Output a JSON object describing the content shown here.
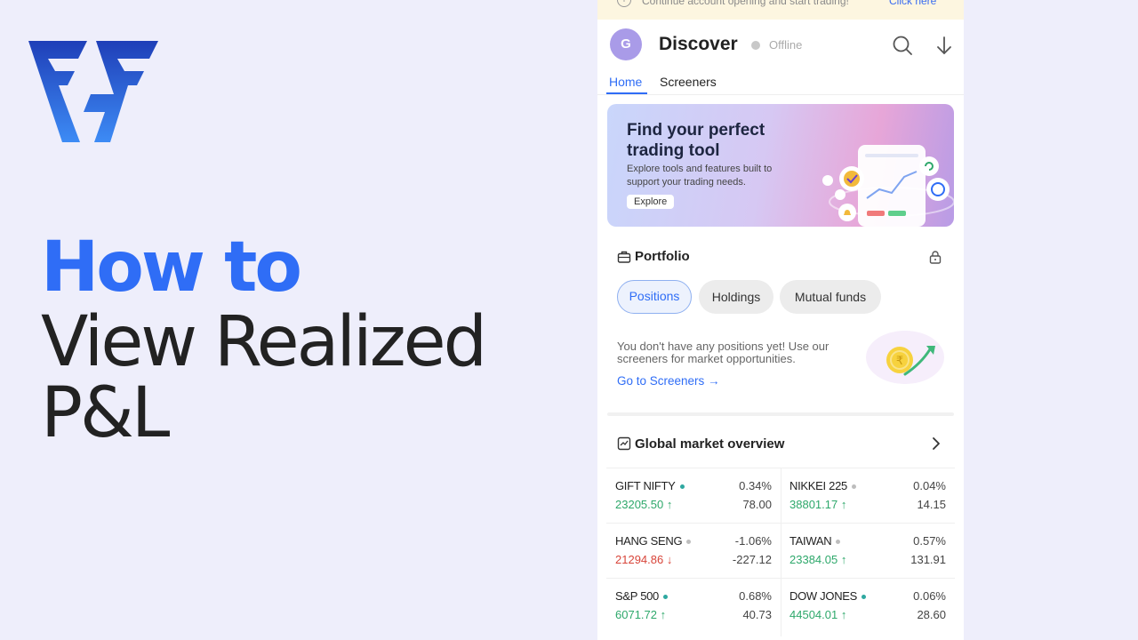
{
  "title": {
    "line1": "How to",
    "line2": "View Realized",
    "line3": "P&L"
  },
  "colors": {
    "accent": "#2f6df6",
    "up": "#2ea86b",
    "down": "#d8453a",
    "background": "#eeeefb"
  },
  "phone": {
    "notice": {
      "text": "Continue account opening and start trading!",
      "link": "Click here"
    },
    "header": {
      "avatar_initial": "G",
      "title": "Discover",
      "status": "Offline",
      "icons": [
        "search-icon",
        "download-icon"
      ]
    },
    "tabs": [
      {
        "label": "Home",
        "active": true
      },
      {
        "label": "Screeners",
        "active": false
      }
    ],
    "banner": {
      "title": "Find your perfect trading tool",
      "description": "Explore tools and features built to support your trading needs.",
      "button": "Explore"
    },
    "portfolio": {
      "title": "Portfolio",
      "chips": [
        {
          "label": "Positions",
          "active": true
        },
        {
          "label": "Holdings",
          "active": false
        },
        {
          "label": "Mutual funds",
          "active": false
        }
      ],
      "empty_text": "You don't have any positions yet! Use our screeners for market opportunities.",
      "link": "Go to Screeners →"
    },
    "market": {
      "title": "Global market overview",
      "items": [
        {
          "name": "GIFT NIFTY",
          "pct": "0.34%",
          "price": "23205.50",
          "arrow": "↑",
          "change": "78.00",
          "direction": "up",
          "dot": "#2ea8a0"
        },
        {
          "name": "NIKKEI 225",
          "pct": "0.04%",
          "price": "38801.17",
          "arrow": "↑",
          "change": "14.15",
          "direction": "up",
          "dot": "#bdbdbd"
        },
        {
          "name": "HANG SENG",
          "pct": "-1.06%",
          "price": "21294.86",
          "arrow": "↓",
          "change": "-227.12",
          "direction": "down",
          "dot": "#bdbdbd"
        },
        {
          "name": "TAIWAN",
          "pct": "0.57%",
          "price": "23384.05",
          "arrow": "↑",
          "change": "131.91",
          "direction": "up",
          "dot": "#bdbdbd"
        },
        {
          "name": "S&P 500",
          "pct": "0.68%",
          "price": "6071.72",
          "arrow": "↑",
          "change": "40.73",
          "direction": "up",
          "dot": "#2ea8a0"
        },
        {
          "name": "DOW JONES",
          "pct": "0.06%",
          "price": "44504.01",
          "arrow": "↑",
          "change": "28.60",
          "direction": "up",
          "dot": "#2ea8a0"
        }
      ]
    }
  }
}
